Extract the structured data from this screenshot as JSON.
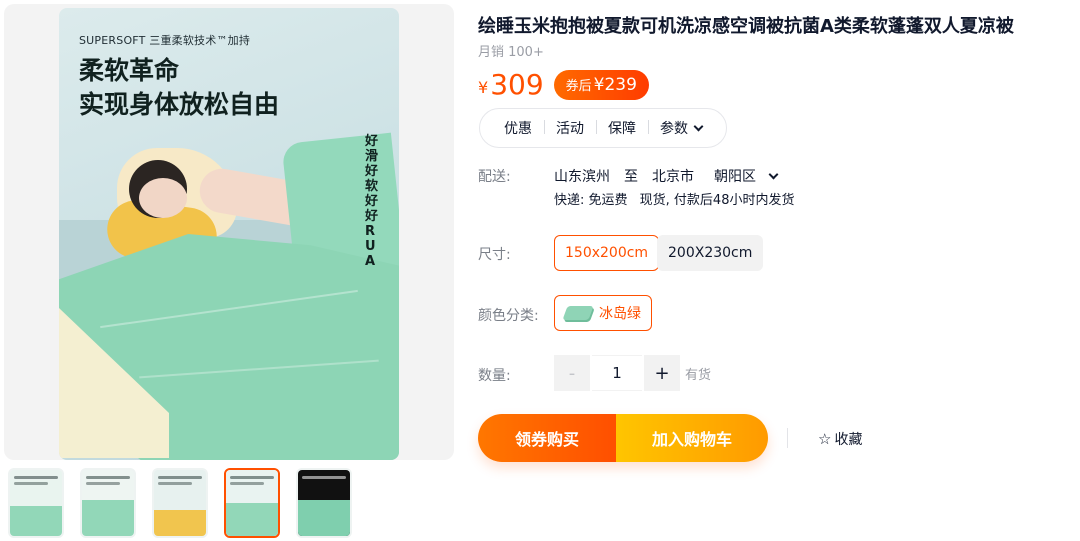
{
  "gallery": {
    "hero": {
      "brand_line": "SUPERSOFT 三重柔软技术™加持",
      "headline_1": "柔软革命",
      "headline_2": "实现身体放松自由",
      "vertical_text": "好滑好软 好好RUA"
    },
    "active_thumb_index": 3,
    "thumb_count": 5
  },
  "product": {
    "title": "绘睡玉米抱抱被夏款可机洗凉感空调被抗菌A类柔软蓬蓬双人夏凉被",
    "monthly_sales": "月销 100+",
    "price_symbol": "¥",
    "price": "309",
    "coupon_label": "券后",
    "coupon_price": "¥239",
    "tabs": [
      "优惠",
      "活动",
      "保障",
      "参数"
    ]
  },
  "shipping": {
    "label": "配送:",
    "from": "山东滨州",
    "to_word": "至",
    "city": "北京市",
    "district": "朝阳区",
    "express": "快递: 免运费",
    "stock_note": "现货, 付款后48小时内发货"
  },
  "size": {
    "label": "尺寸:",
    "options": [
      "150x200cm",
      "200X230cm"
    ],
    "selected": "150x200cm"
  },
  "color": {
    "label": "颜色分类:",
    "options": [
      "冰岛绿"
    ],
    "selected": "冰岛绿"
  },
  "quantity": {
    "label": "数量:",
    "value": "1",
    "minus": "-",
    "plus": "+",
    "stock": "有货"
  },
  "actions": {
    "buy_label": "领券购买",
    "cart_label": "加入购物车",
    "favorite_label": "收藏",
    "favorite_icon": "star-outline-icon"
  },
  "colors": {
    "accent": "#ff5000",
    "cart_yellow": "#ffb400",
    "text_muted": "#9a9da5"
  }
}
